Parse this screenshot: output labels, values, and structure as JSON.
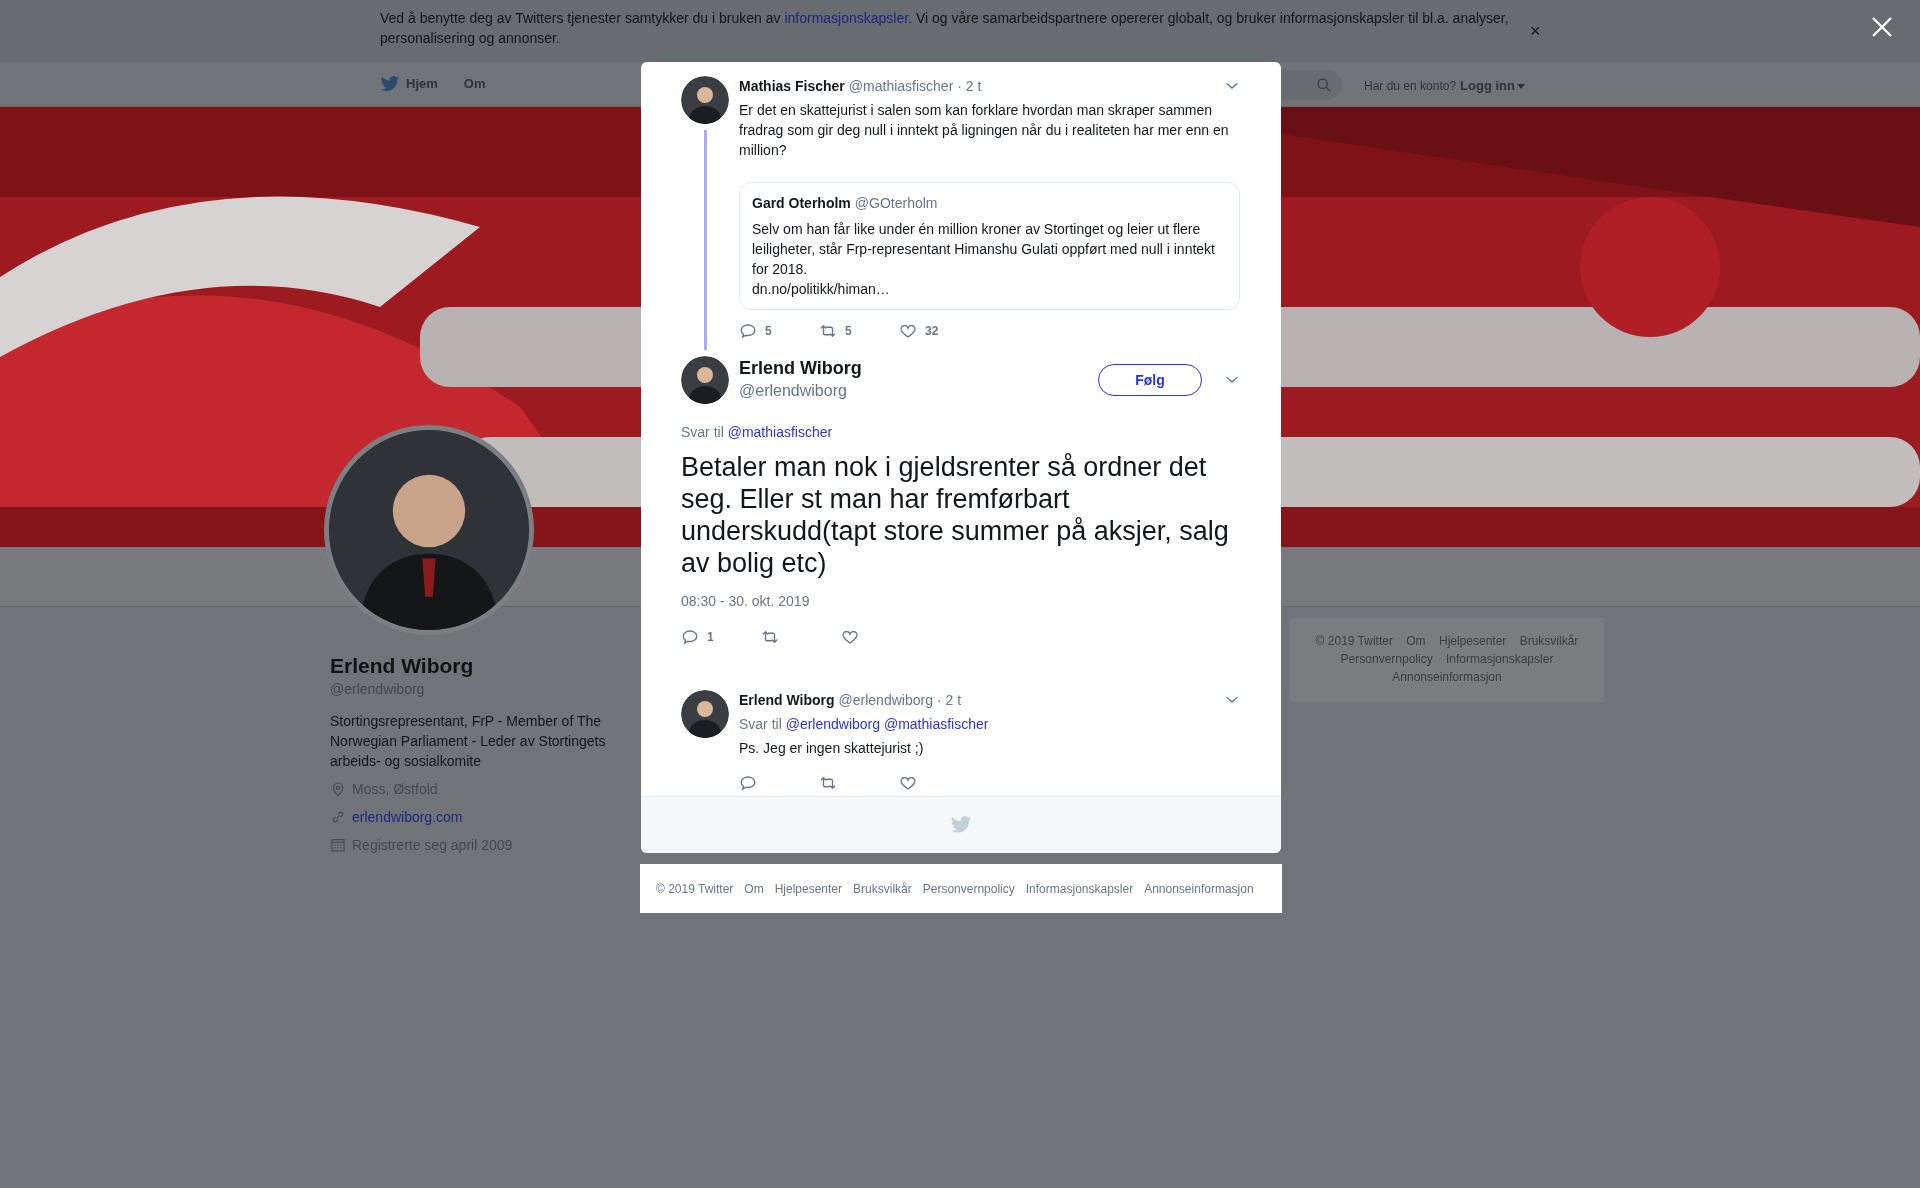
{
  "cookie_banner": {
    "text_before": "Ved å benytte deg av Twitters tjenester samtykker du i bruken av ",
    "link": "informasjonskapsler",
    "text_after": ". Vi og våre samarbeidspartnere opererer globalt, og bruker informasjonskapsler til bl.a. analyser, personalisering og annonser.",
    "close": "×"
  },
  "nav": {
    "items": [
      {
        "label": "Hjem",
        "kind": "home"
      },
      {
        "label": "Om",
        "kind": "plain"
      }
    ],
    "account_prompt": "Har du en konto?",
    "login": "Logg inn"
  },
  "profile": {
    "name": "Erlend Wiborg",
    "handle": "@erlendwiborg",
    "bio": "Stortingsrepresentant, FrP - Member of The Norwegian Parliament - Leder av Stortingets arbeids- og sosialkomite",
    "details": [
      {
        "kind": "location",
        "text": "Moss, Østfold"
      },
      {
        "kind": "link",
        "text": "erlendwiborg.com"
      },
      {
        "kind": "joined",
        "text": "Registrerte seg april 2009"
      }
    ]
  },
  "side_footer": {
    "links": [
      "© 2019 Twitter",
      "Om",
      "Hjelpesenter",
      "Bruksvilkår",
      "Personvernpolicy",
      "Informasjonskapsler",
      "Annonseinformasjon"
    ]
  },
  "thread": [
    {
      "kind": "compact",
      "author": {
        "name": "Mathias Fischer",
        "handle": "@mathiasfischer"
      },
      "time": "· 2 t",
      "text": "Er det en skattejurist i salen som kan forklare hvordan man skraper sammen fradrag som gir deg null i inntekt på ligningen når du i realiteten har mer enn en million?",
      "quote": {
        "name": "Gard Oterholm",
        "handle": "@GOterholm",
        "text": "Selv om han får like under én million kroner av Stortinget og leier ut flere leiligheter, står Frp-representant Himanshu Gulati oppført med null i inntekt for 2018.",
        "link": "dn.no/politikk/himan…"
      },
      "connected": true,
      "actions": [
        {
          "kind": "reply",
          "count": "5"
        },
        {
          "kind": "retweet",
          "count": "5"
        },
        {
          "kind": "like",
          "count": "32"
        }
      ]
    },
    {
      "kind": "focus",
      "author": {
        "name": "Erlend Wiborg",
        "handle": "@erlendwiborg"
      },
      "follow_button": "Følg",
      "reply_to": {
        "label": "Svar til",
        "mentions": [
          "@mathiasfischer"
        ]
      },
      "text": "Betaler man nok i gjeldsrenter så ordner det seg. Eller st man har fremførbart underskudd(tapt store summer på aksjer, salg av bolig etc)",
      "timestamp": "08:30 - 30. okt. 2019",
      "actions": [
        {
          "kind": "reply",
          "count": "1"
        },
        {
          "kind": "retweet"
        },
        {
          "kind": "like"
        }
      ]
    },
    {
      "kind": "compact",
      "author": {
        "name": "Erlend Wiborg",
        "handle": "@erlendwiborg"
      },
      "time": "· 2 t",
      "reply_to": {
        "label": "Svar til",
        "mentions": [
          "@erlendwiborg",
          "@mathiasfischer"
        ]
      },
      "text": "Ps. Jeg er ingen skattejurist ;)",
      "connected": false,
      "actions": [
        {
          "kind": "reply"
        },
        {
          "kind": "retweet"
        },
        {
          "kind": "like"
        }
      ]
    }
  ],
  "page_footer": {
    "links": [
      "© 2019 Twitter",
      "Om",
      "Hjelpesenter",
      "Bruksvilkår",
      "Personvernpolicy",
      "Informasjonskapsler",
      "Annonseinformasjon"
    ]
  }
}
